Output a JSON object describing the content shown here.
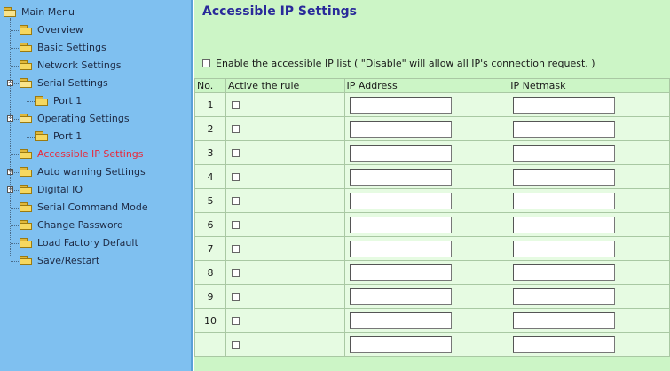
{
  "sidebar": {
    "items": [
      {
        "label": "Main Menu",
        "depth": 0,
        "expander": "",
        "open": true,
        "active": false,
        "clickable": true
      },
      {
        "label": "Overview",
        "depth": 1,
        "expander": "",
        "open": false,
        "active": false,
        "clickable": true
      },
      {
        "label": "Basic Settings",
        "depth": 1,
        "expander": "",
        "open": false,
        "active": false,
        "clickable": true
      },
      {
        "label": "Network Settings",
        "depth": 1,
        "expander": "",
        "open": false,
        "active": false,
        "clickable": true
      },
      {
        "label": "Serial Settings",
        "depth": 1,
        "expander": "−",
        "open": true,
        "active": false,
        "clickable": true
      },
      {
        "label": "Port 1",
        "depth": 2,
        "expander": "",
        "open": false,
        "active": false,
        "clickable": true
      },
      {
        "label": "Operating Settings",
        "depth": 1,
        "expander": "−",
        "open": true,
        "active": false,
        "clickable": true
      },
      {
        "label": "Port 1",
        "depth": 2,
        "expander": "",
        "open": false,
        "active": false,
        "clickable": true
      },
      {
        "label": "Accessible IP Settings",
        "depth": 1,
        "expander": "",
        "open": false,
        "active": true,
        "clickable": true
      },
      {
        "label": "Auto warning Settings",
        "depth": 1,
        "expander": "+",
        "open": false,
        "active": false,
        "clickable": true
      },
      {
        "label": "Digital IO",
        "depth": 1,
        "expander": "+",
        "open": false,
        "active": false,
        "clickable": true
      },
      {
        "label": "Serial Command Mode",
        "depth": 1,
        "expander": "",
        "open": false,
        "active": false,
        "clickable": true
      },
      {
        "label": "Change Password",
        "depth": 1,
        "expander": "",
        "open": false,
        "active": false,
        "clickable": true
      },
      {
        "label": "Load Factory Default",
        "depth": 1,
        "expander": "",
        "open": false,
        "active": false,
        "clickable": true
      },
      {
        "label": "Save/Restart",
        "depth": 1,
        "expander": "",
        "open": false,
        "active": false,
        "clickable": true
      }
    ],
    "colors": {
      "background": "#7fc0f0",
      "active_text": "#e8283a"
    }
  },
  "main": {
    "title": "Accessible IP Settings",
    "enable_label": "Enable the accessible IP list ( \"Disable\" will allow all IP's connection request. )",
    "enable_checked": false,
    "table": {
      "headers": {
        "no": "No.",
        "active": "Active the rule",
        "ip": "IP Address",
        "netmask": "IP Netmask"
      },
      "rows": [
        {
          "no": "1",
          "active": false,
          "ip": "",
          "netmask": ""
        },
        {
          "no": "2",
          "active": false,
          "ip": "",
          "netmask": ""
        },
        {
          "no": "3",
          "active": false,
          "ip": "",
          "netmask": ""
        },
        {
          "no": "4",
          "active": false,
          "ip": "",
          "netmask": ""
        },
        {
          "no": "5",
          "active": false,
          "ip": "",
          "netmask": ""
        },
        {
          "no": "6",
          "active": false,
          "ip": "",
          "netmask": ""
        },
        {
          "no": "7",
          "active": false,
          "ip": "",
          "netmask": ""
        },
        {
          "no": "8",
          "active": false,
          "ip": "",
          "netmask": ""
        },
        {
          "no": "9",
          "active": false,
          "ip": "",
          "netmask": ""
        },
        {
          "no": "10",
          "active": false,
          "ip": "",
          "netmask": ""
        },
        {
          "no": "",
          "active": false,
          "ip": "",
          "netmask": ""
        }
      ]
    },
    "colors": {
      "background": "#ccf5c6",
      "title": "#2a2a9a"
    }
  }
}
